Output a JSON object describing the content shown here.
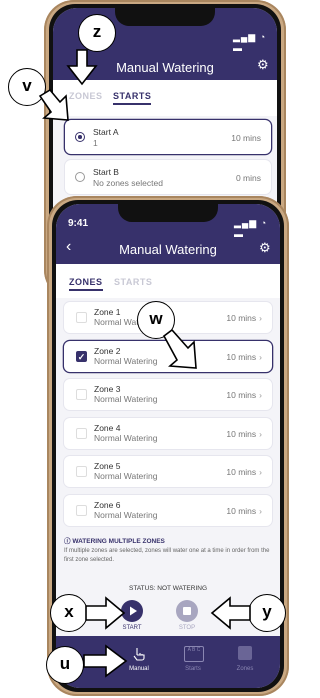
{
  "back_screen": {
    "title": "Manual Watering",
    "tabs": {
      "zones": "ZONES",
      "starts": "STARTS"
    },
    "starts": [
      {
        "name": "Start A",
        "detail": "1",
        "duration": "10 mins",
        "selected": true
      },
      {
        "name": "Start B",
        "detail": "No zones selected",
        "duration": "0 mins",
        "selected": false
      }
    ]
  },
  "front_screen": {
    "time": "9:41",
    "title": "Manual Watering",
    "tabs": {
      "zones": "ZONES",
      "starts": "STARTS"
    },
    "zones": [
      {
        "name": "Zone 1",
        "mode": "Normal Watering",
        "duration": "10 mins",
        "checked": false
      },
      {
        "name": "Zone 2",
        "mode": "Normal Watering",
        "duration": "10 mins",
        "checked": true
      },
      {
        "name": "Zone 3",
        "mode": "Normal Watering",
        "duration": "10 mins",
        "checked": false
      },
      {
        "name": "Zone 4",
        "mode": "Normal Watering",
        "duration": "10 mins",
        "checked": false
      },
      {
        "name": "Zone 5",
        "mode": "Normal Watering",
        "duration": "10 mins",
        "checked": false
      },
      {
        "name": "Zone 6",
        "mode": "Normal Watering",
        "duration": "10 mins",
        "checked": false
      }
    ],
    "info_title": "WATERING MULTIPLE ZONES",
    "info_body": "If multiple zones are selected, zones will water one at a time in order from the first zone selected.",
    "status": "STATUS: NOT WATERING",
    "start_label": "START",
    "stop_label": "STOP",
    "nav": {
      "manual": "Manual",
      "starts": "Starts",
      "starts_icon_text": "A B C",
      "zones": "Zones"
    }
  },
  "callouts": {
    "z": "z",
    "v": "v",
    "w": "w",
    "x": "x",
    "y": "y",
    "u": "u"
  },
  "colors": {
    "header": "#37316b",
    "accent": "#37316b",
    "stop": "#a8a6c0",
    "phone_frame": "#c9a882"
  },
  "icons": [
    "gear-icon",
    "back-chevron-icon",
    "play-icon",
    "stop-icon",
    "hand-tap-icon",
    "abc-calendar-icon",
    "zones-icon",
    "signal-icon",
    "wifi-icon",
    "battery-icon",
    "chevron-right-icon"
  ]
}
